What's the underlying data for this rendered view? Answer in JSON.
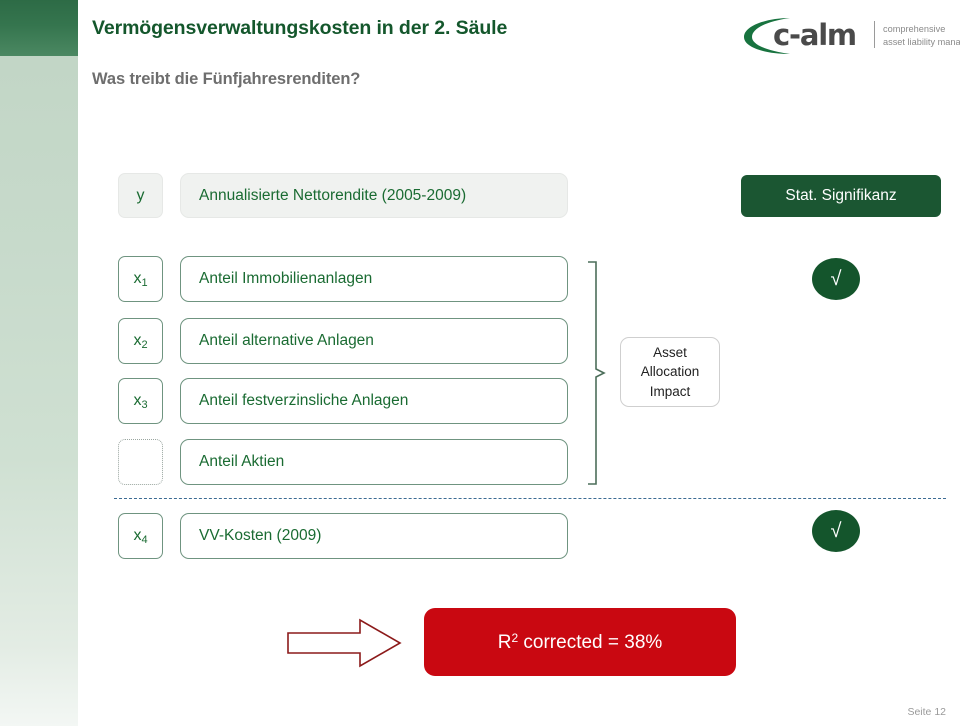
{
  "header": {
    "title": "Vermögensverwaltungskosten in der 2. Säule",
    "subtitle": "Was treibt die Fünfjahresrenditen?"
  },
  "logo": {
    "wordmark": "c-alm",
    "tagline_line1": "comprehensive",
    "tagline_line2": "asset liability management"
  },
  "colors": {
    "brand_green": "#14572c",
    "box_green_text": "#1a6b32",
    "box_border_green": "#6f9480",
    "dark_pill_green": "#1b5632",
    "result_red": "#c90811",
    "arrow_outline_red": "#8c1a1a",
    "separator_blue": "#3c6b93",
    "subtitle_grey": "#6e6e6e"
  },
  "dependent": {
    "tag": "y",
    "label": "Annualisierte Nettorendite (2005-2009)"
  },
  "significance_header": "Stat. Signifikanz",
  "variables": [
    {
      "tag": "x",
      "sub": "1",
      "label": "Anteil Immobilienanlagen",
      "significant": true,
      "check": "√",
      "dashed_tag": false
    },
    {
      "tag": "x",
      "sub": "2",
      "label": "Anteil alternative Anlagen",
      "significant": false,
      "check": "",
      "dashed_tag": false
    },
    {
      "tag": "x",
      "sub": "3",
      "label": "Anteil festverzinsliche Anlagen",
      "significant": false,
      "check": "",
      "dashed_tag": false
    },
    {
      "tag": "",
      "sub": "",
      "label": "Anteil Aktien",
      "significant": false,
      "check": "",
      "dashed_tag": true
    },
    {
      "tag": "x",
      "sub": "4",
      "label": "VV-Kosten (2009)",
      "significant": true,
      "check": "√",
      "dashed_tag": false
    }
  ],
  "group_annotation": {
    "line1": "Asset",
    "line2": "Allocation",
    "line3": "Impact"
  },
  "result": {
    "label_main": "R",
    "label_sup": "2",
    "label_rest": " corrected = 38%"
  },
  "footer": {
    "page": "Seite 12"
  }
}
